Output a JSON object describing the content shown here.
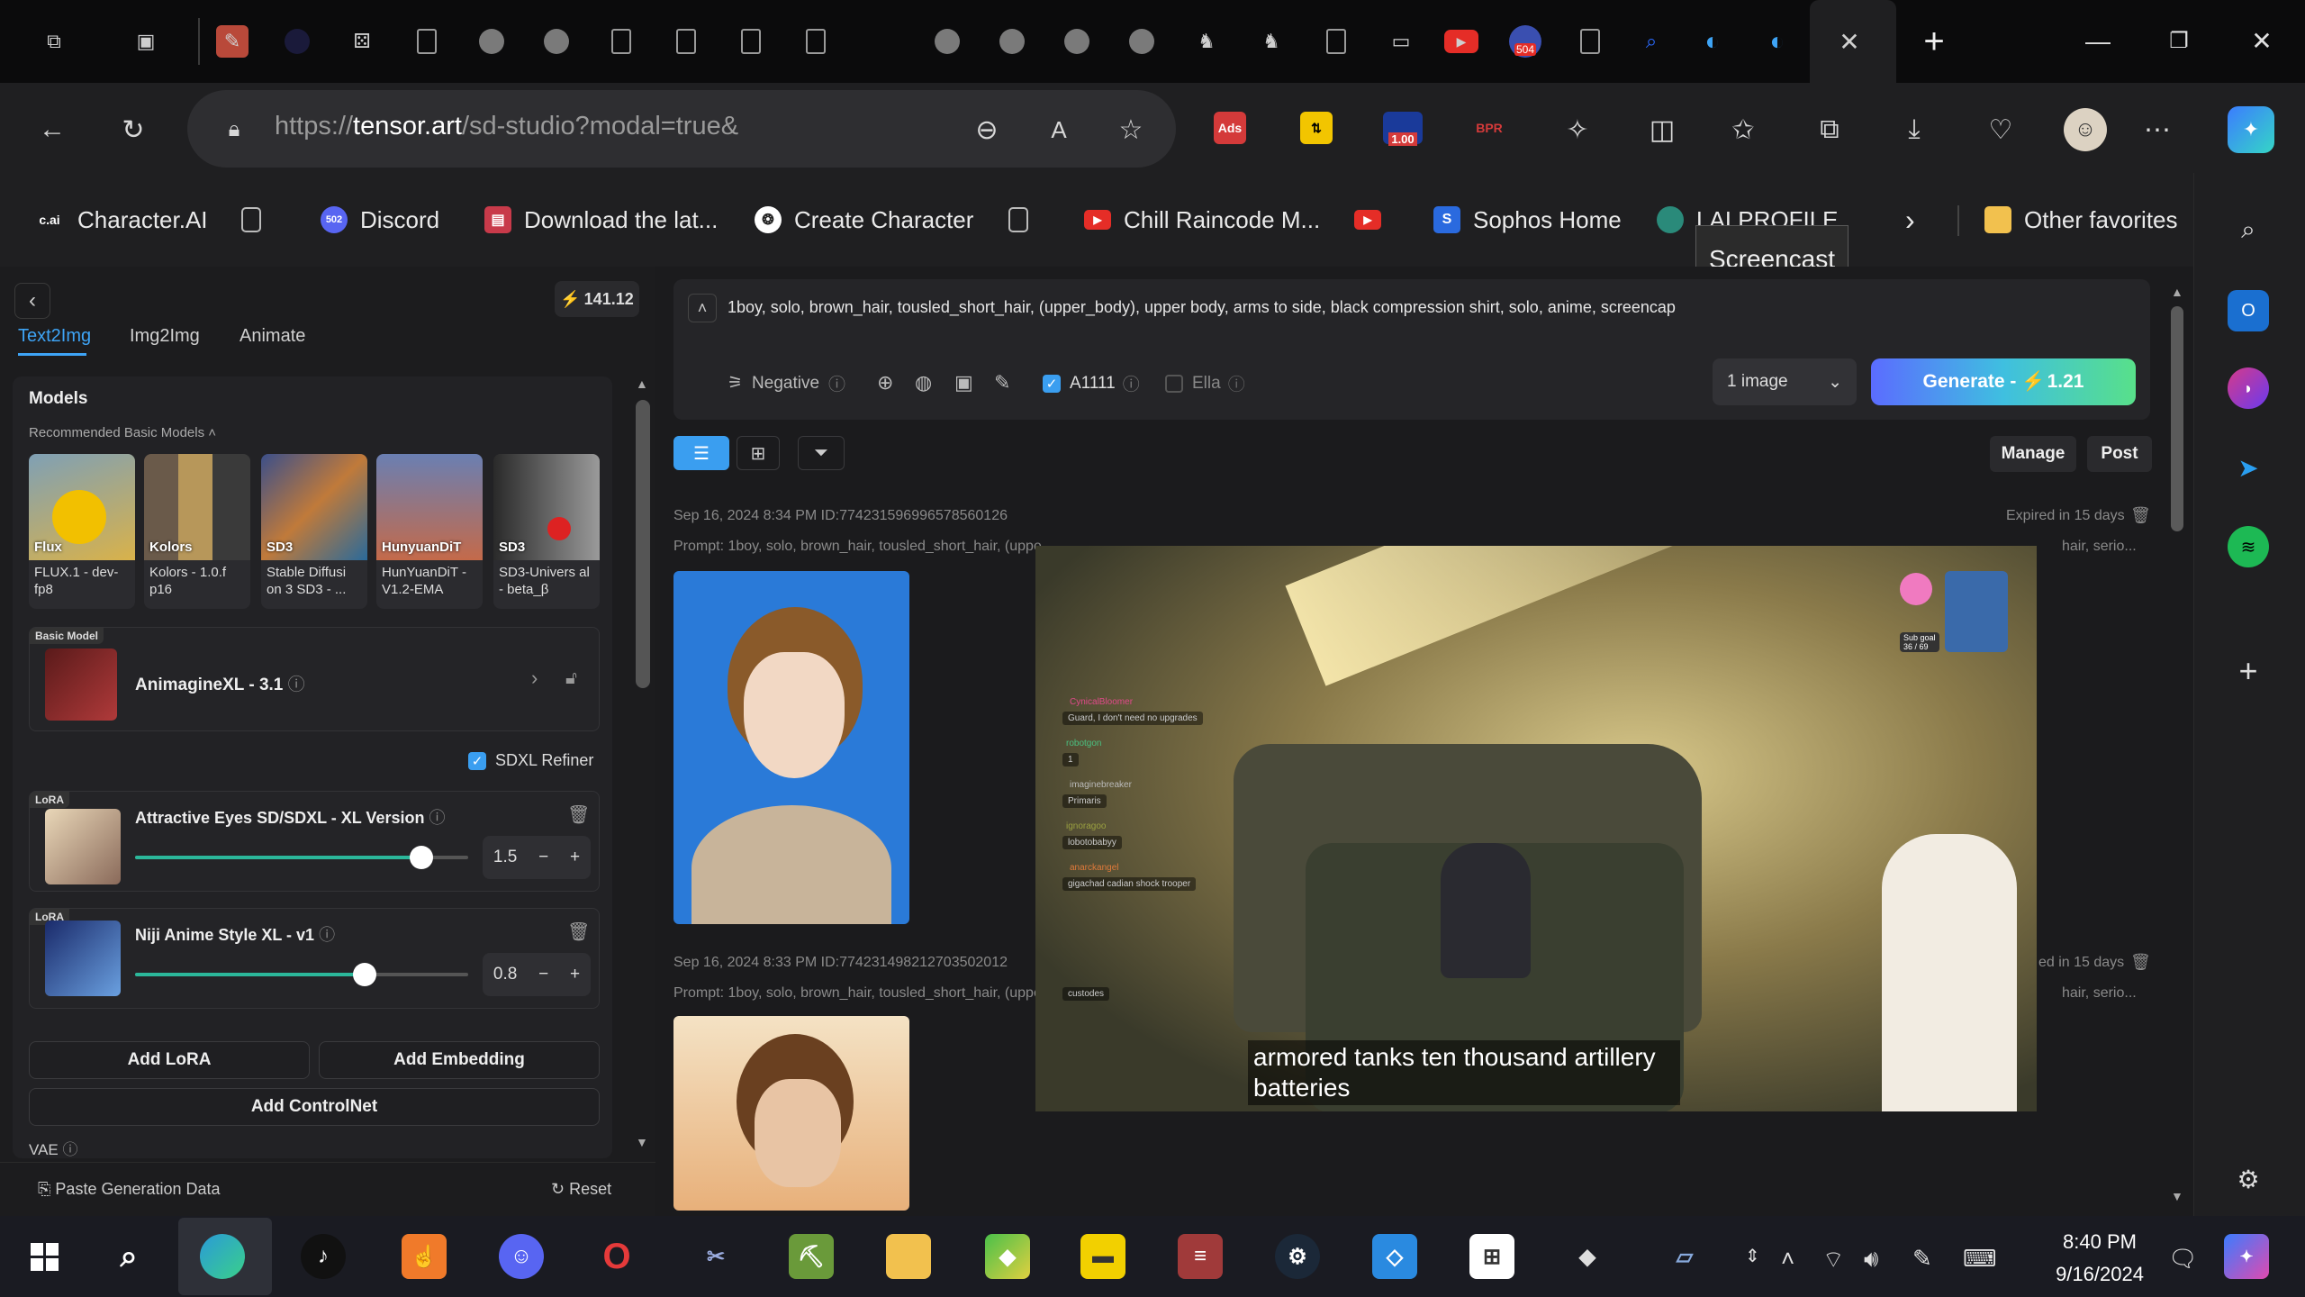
{
  "browser": {
    "url_prefix": "https://",
    "url_domain": "tensor.art",
    "url_rest": "/sd-studio?modal=true&",
    "tab_badges": {
      "yt_count": "504",
      "zoom_badge": "1.00"
    }
  },
  "favorites": [
    {
      "label": "Character.AI",
      "icon": "c.ai"
    },
    {
      "label": "",
      "icon": "doc-icon"
    },
    {
      "label": "Discord",
      "icon": "502"
    },
    {
      "label": "Download the lat...",
      "icon": "download-icon"
    },
    {
      "label": "Create Character",
      "icon": "openai-icon"
    },
    {
      "label": "",
      "icon": "doc-icon"
    },
    {
      "label": "Chill Raincode M...",
      "icon": "youtube-icon"
    },
    {
      "label": "",
      "icon": "youtube-icon"
    },
    {
      "label": "Sophos Home",
      "icon": "S"
    },
    {
      "label": "LAI PROFILE",
      "icon": "avatar-icon"
    },
    {
      "label": "Other favorites",
      "icon": "folder-icon"
    }
  ],
  "tooltip": "Screencast",
  "left": {
    "credits": "141.12",
    "tabs": [
      "Text2Img",
      "Img2Img",
      "Animate"
    ],
    "models_title": "Models",
    "recommended_label": "Recommended Basic Models",
    "model_cards": [
      {
        "tag": "Flux",
        "name": "FLUX.1 - dev-fp8",
        "colors": [
          "#d9b24a",
          "#7fa0b5"
        ]
      },
      {
        "tag": "Kolors",
        "name": "Kolors - 1.0.f p16",
        "colors": [
          "#6a5a4a",
          "#b7975a"
        ]
      },
      {
        "tag": "SD3",
        "name": "Stable Diffusi on 3 SD3 - ...",
        "colors": [
          "#3b4f8a",
          "#c07a3a"
        ]
      },
      {
        "tag": "HunyuanDiT",
        "name": "HunYuanDiT - V1.2-EMA",
        "colors": [
          "#6a7fb2",
          "#c46a4a"
        ]
      },
      {
        "tag": "SD3",
        "name": "SD3-Univers al - beta_β",
        "colors": [
          "#2a2a2a",
          "#9a9a9a"
        ]
      }
    ],
    "basic_model": {
      "pill": "Basic Model",
      "name": "AnimagineXL - 3.1"
    },
    "refiner_label": "SDXL Refiner",
    "loras": [
      {
        "pill": "LoRA",
        "name": "Attractive Eyes SD/SDXL - XL Version",
        "weight": "1.5",
        "level": 0.86
      },
      {
        "pill": "LoRA",
        "name": "Niji Anime Style XL - v1",
        "weight": "0.8",
        "level": 0.69
      }
    ],
    "add_lora": "Add LoRA",
    "add_embedding": "Add Embedding",
    "add_controlnet": "Add ControlNet",
    "vae_label": "VAE",
    "paste_label": "Paste Generation Data",
    "reset_label": "Reset"
  },
  "main": {
    "prompt": "1boy, solo, brown_hair, tousled_short_hair, (upper_body), upper body, arms to side, black compression shirt, solo, anime, screencap",
    "negative_label": "Negative",
    "a1111_label": "A1111",
    "ella_label": "Ella",
    "image_count": "1 image",
    "generate_label": "Generate - ",
    "generate_cost": "1.21",
    "manage_label": "Manage",
    "post_label": "Post",
    "results": [
      {
        "meta": "Sep 16, 2024 8:34 PM ID:774231596996578560126",
        "expires": "Expired in 15 days",
        "prompt_line": "Prompt: 1boy, solo, brown_hair, tousled_short_hair, (uppe",
        "prompt_tail": "hair, serio..."
      },
      {
        "meta": "Sep 16, 2024 8:33 PM ID:774231498212703502012",
        "expires": "ed in 15 days",
        "prompt_line": "Prompt: 1boy, solo, brown_hair, tousled_short_hair, (uppe",
        "prompt_tail": "hair, serio..."
      }
    ]
  },
  "overlay": {
    "subtitle": "armored tanks ten thousand artillery batteries",
    "sub_goal": "Sub goal",
    "sub_goal_count": "36 / 69",
    "chat": [
      {
        "name": "CynicalBloomer",
        "msg": "Guard, I don't need no upgrades"
      },
      {
        "name": "robotgon",
        "msg": "1"
      },
      {
        "name": "imaginebreaker",
        "msg": "Primaris"
      },
      {
        "name": "ignoragoo",
        "msg": "lobotobabyy"
      },
      {
        "name": "anarckangel",
        "msg": "gigachad cadian shock trooper"
      },
      {
        "name": "",
        "msg": "custodes"
      }
    ]
  },
  "taskbar": {
    "time": "8:40 PM",
    "date": "9/16/2024"
  }
}
